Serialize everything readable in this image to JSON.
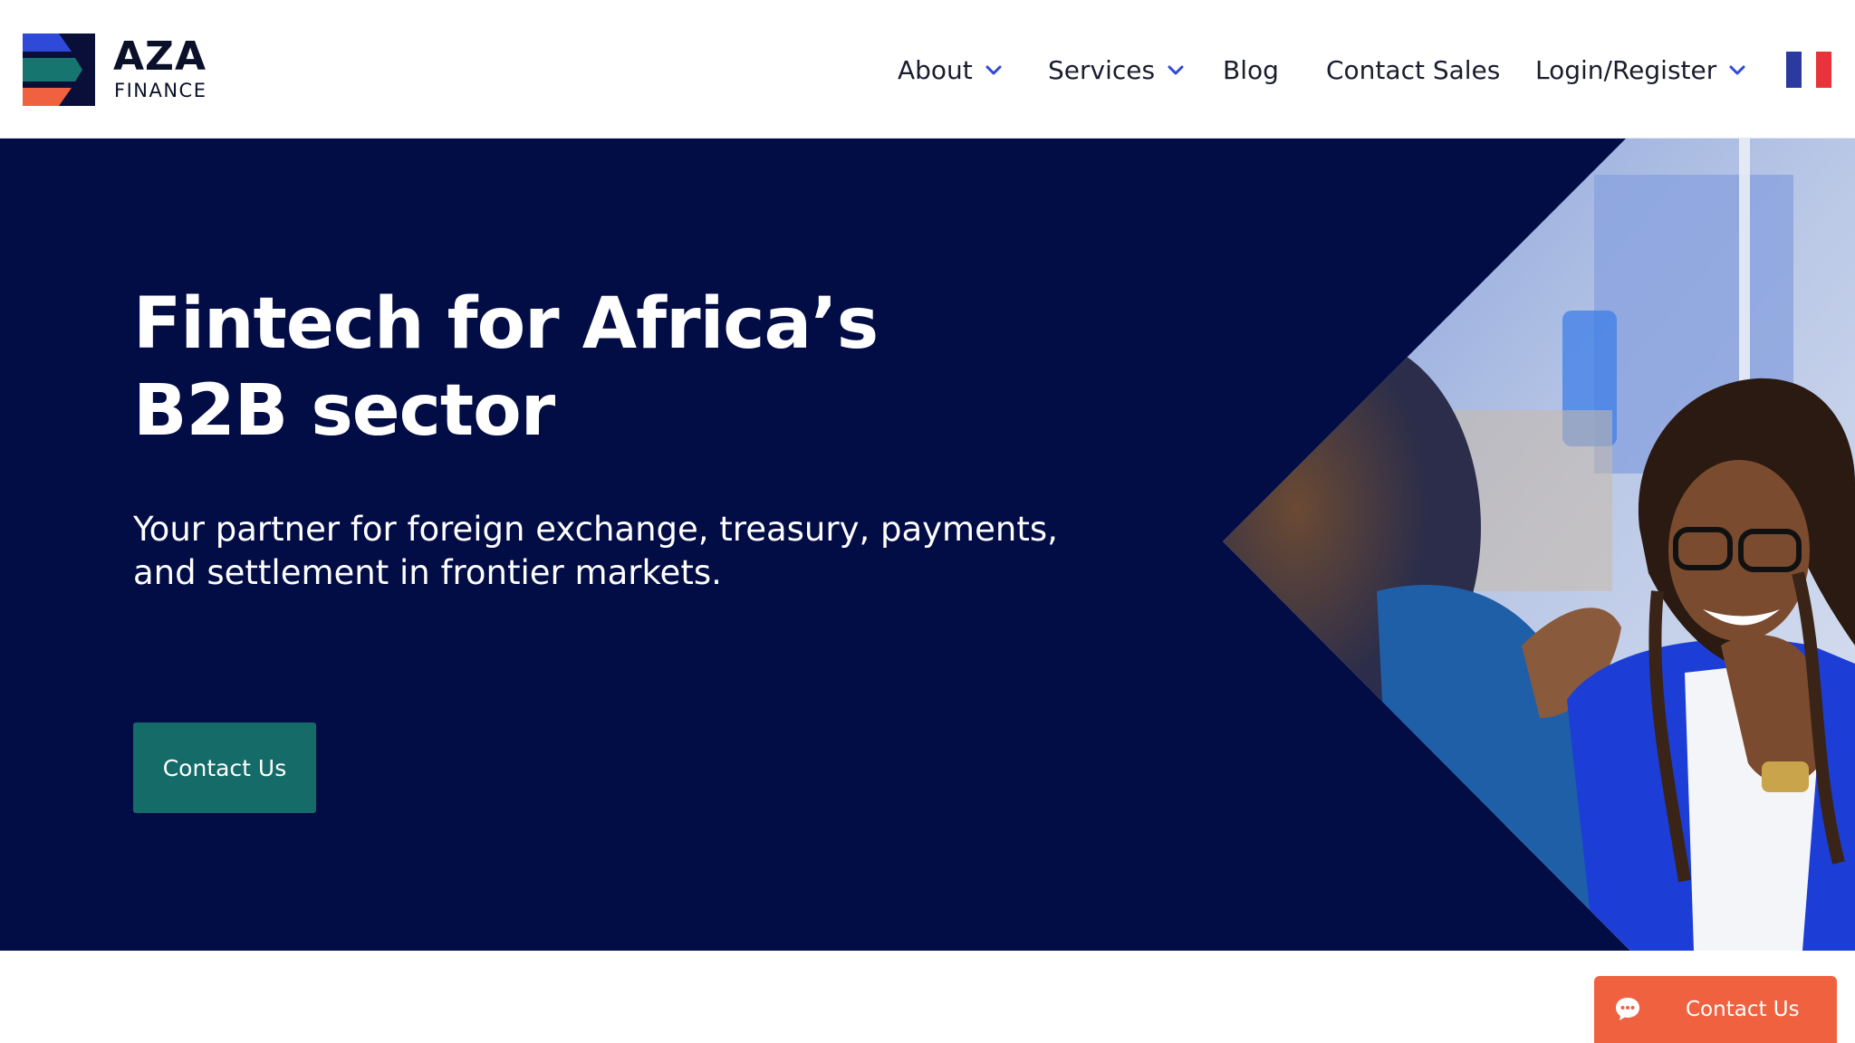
{
  "brand": {
    "name": "AZA",
    "subtitle": "FINANCE",
    "colors": {
      "blue": "#2f49d8",
      "teal": "#17756f",
      "orange": "#f0623f",
      "navy": "#0a0f3a"
    }
  },
  "nav": {
    "items": [
      {
        "label": "About",
        "has_dropdown": true,
        "icon": "chevron-down-icon"
      },
      {
        "label": "Services",
        "has_dropdown": true,
        "icon": "chevron-down-icon"
      },
      {
        "label": "Blog",
        "has_dropdown": false
      },
      {
        "label": "Contact Sales",
        "has_dropdown": false
      },
      {
        "label": "Login/Register",
        "has_dropdown": true,
        "icon": "chevron-down-icon"
      }
    ],
    "language_flag": {
      "icon": "french-flag-icon",
      "colors": [
        "#2a3a9e",
        "#ffffff",
        "#e8333a"
      ]
    },
    "chevron_color": "#2f49d8"
  },
  "hero": {
    "title_line1": "Fintech for Africa’s",
    "title_line2": "B2B sector",
    "subtitle": "Your partner for foreign exchange, treasury, payments, and settlement in frontier markets.",
    "cta_label": "Contact Us",
    "background_color": "#020c45",
    "cta_color": "#156b68"
  },
  "floating_contact": {
    "label": "Contact Us",
    "icon": "chat-bubble-icon",
    "color": "#f0623f"
  }
}
